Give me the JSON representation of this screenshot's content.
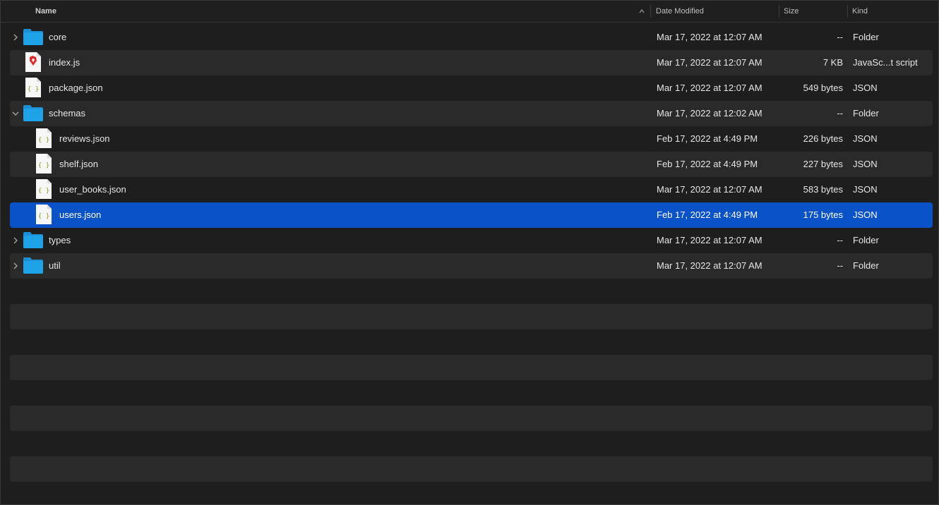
{
  "header": {
    "name": "Name",
    "date_modified": "Date Modified",
    "size": "Size",
    "kind": "Kind"
  },
  "rows": [
    {
      "name": "core",
      "date": "Mar 17, 2022 at 12:07 AM",
      "size": "--",
      "kind": "Folder",
      "icon": "folder-icon",
      "level": 0,
      "disclosure": "collapsed"
    },
    {
      "name": "index.js",
      "date": "Mar 17, 2022 at 12:07 AM",
      "size": "7 KB",
      "kind": "JavaSc...t script",
      "icon": "brave-js-file-icon",
      "level": 0,
      "disclosure": "none"
    },
    {
      "name": "package.json",
      "date": "Mar 17, 2022 at 12:07 AM",
      "size": "549 bytes",
      "kind": "JSON",
      "icon": "json-file-icon",
      "level": 0,
      "disclosure": "none"
    },
    {
      "name": "schemas",
      "date": "Mar 17, 2022 at 12:02 AM",
      "size": "--",
      "kind": "Folder",
      "icon": "folder-icon",
      "level": 0,
      "disclosure": "expanded"
    },
    {
      "name": "reviews.json",
      "date": "Feb 17, 2022 at 4:49 PM",
      "size": "226 bytes",
      "kind": "JSON",
      "icon": "json-file-icon",
      "level": 1,
      "disclosure": "none"
    },
    {
      "name": "shelf.json",
      "date": "Feb 17, 2022 at 4:49 PM",
      "size": "227 bytes",
      "kind": "JSON",
      "icon": "json-file-icon",
      "level": 1,
      "disclosure": "none"
    },
    {
      "name": "user_books.json",
      "date": "Mar 17, 2022 at 12:07 AM",
      "size": "583 bytes",
      "kind": "JSON",
      "icon": "json-file-icon",
      "level": 1,
      "disclosure": "none"
    },
    {
      "name": "users.json",
      "date": "Feb 17, 2022 at 4:49 PM",
      "size": "175 bytes",
      "kind": "JSON",
      "icon": "json-file-icon",
      "level": 1,
      "disclosure": "none",
      "selected": true
    },
    {
      "name": "types",
      "date": "Mar 17, 2022 at 12:07 AM",
      "size": "--",
      "kind": "Folder",
      "icon": "folder-icon",
      "level": 0,
      "disclosure": "collapsed"
    },
    {
      "name": "util",
      "date": "Mar 17, 2022 at 12:07 AM",
      "size": "--",
      "kind": "Folder",
      "icon": "folder-icon",
      "level": 0,
      "disclosure": "collapsed"
    }
  ],
  "colors": {
    "selection": "#0a52c7",
    "folder": "#1fa3e8",
    "alt_row": "#2a2a2a",
    "background": "#1e1e1e"
  }
}
